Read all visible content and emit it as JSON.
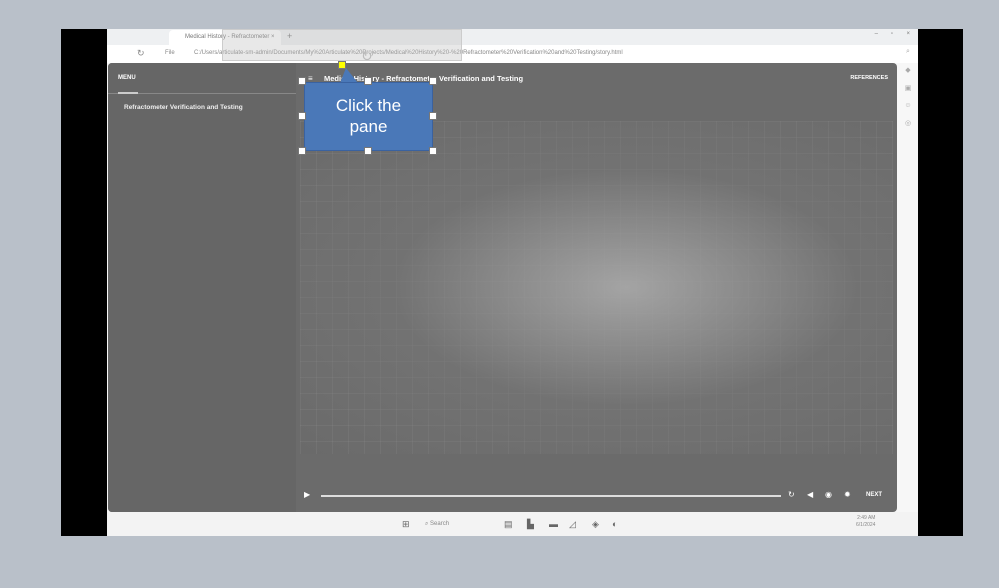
{
  "browser": {
    "tab_title": "Medical History - Refractometer",
    "new_tab": "+",
    "url": "C:/Users/articulate-sm-admin/Documents/My%20Articulate%20Projects/Medical%20History%20-%20Refractometer%20Verification%20and%20Testing/story.html",
    "file_label": "File"
  },
  "player": {
    "menu_label": "MENU",
    "menu_item": "Refractometer Verification and Testing",
    "title": "Medical History - Refractometer Verification and Testing",
    "references_label": "REFERENCES",
    "next_label": "NEXT"
  },
  "callout": {
    "text_line1": "Click the",
    "text_line2": "pane"
  },
  "taskbar": {
    "search_placeholder": "Search",
    "time": "2:49 AM",
    "date": "6/1/2024"
  }
}
